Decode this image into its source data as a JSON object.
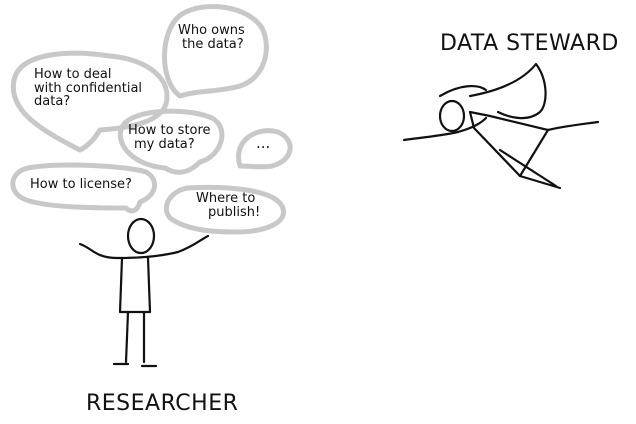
{
  "labels": {
    "steward": "DATA STEWARD",
    "researcher": "RESEARCHER"
  },
  "questions": {
    "owner": [
      "Who owns",
      "the data?"
    ],
    "confidential": [
      "How to deal",
      "with confidential",
      "data?"
    ],
    "store": [
      "How to store",
      "my data?"
    ],
    "etc": "...",
    "license": "How to license?",
    "publish": [
      "Where to",
      "publish!"
    ]
  },
  "colors": {
    "bubble": "#c8c8c8",
    "ink": "#111111"
  }
}
